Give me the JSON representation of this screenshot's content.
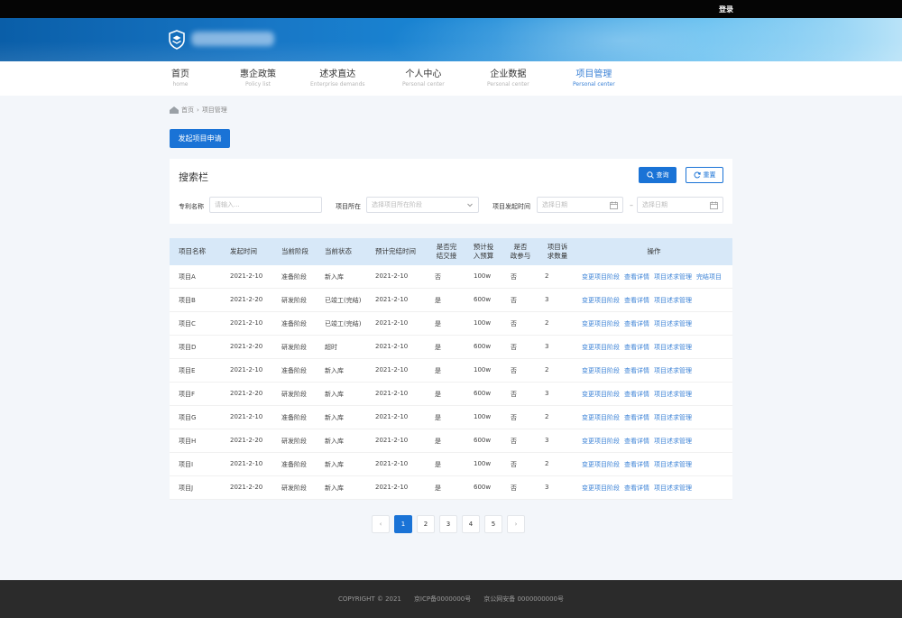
{
  "topbar": {
    "login": "登录"
  },
  "nav": [
    {
      "cn": "首页",
      "en": "home",
      "active": false
    },
    {
      "cn": "惠企政策",
      "en": "Policy list",
      "active": false
    },
    {
      "cn": "述求直达",
      "en": "Enterprise demands",
      "active": false
    },
    {
      "cn": "个人中心",
      "en": "Personal center",
      "active": false
    },
    {
      "cn": "企业数据",
      "en": "Personal center",
      "active": false
    },
    {
      "cn": "项目管理",
      "en": "Personal center",
      "active": true
    }
  ],
  "breadcrumb": {
    "home": "首页",
    "separator": "›",
    "current": "项目管理"
  },
  "actions": {
    "create": "发起项目申请"
  },
  "search": {
    "title": "搜索栏",
    "query": "查询",
    "reset": "重置",
    "patent_label": "专利名称",
    "patent_placeholder": "请输入...",
    "location_label": "项目所在",
    "location_placeholder": "选择项目所在阶段",
    "date_label": "项目发起时间",
    "date_start_placeholder": "选择日期",
    "date_end_placeholder": "选择日期",
    "range_sep": "–"
  },
  "table": {
    "headers": [
      "项目名称",
      "发起时间",
      "当前阶段",
      "当前状态",
      "预计完结时间",
      "是否完\n结交接",
      "预计投\n入预算",
      "是否\n政参与",
      "项目诉\n求数量",
      "操作"
    ],
    "rows": [
      {
        "name": "项目A",
        "start": "2021-2-10",
        "stage": "准备阶段",
        "status": "新入库",
        "end": "2021-2-10",
        "handover": "否",
        "budget": "100w",
        "gov": "否",
        "count": "2",
        "ops": [
          "变更项目阶段",
          "查看详情",
          "项目述求管理",
          "完结项目"
        ]
      },
      {
        "name": "项目B",
        "start": "2021-2-20",
        "stage": "研发阶段",
        "status": "已竣工(完结)",
        "end": "2021-2-10",
        "handover": "是",
        "budget": "600w",
        "gov": "否",
        "count": "3",
        "ops": [
          "变更项目阶段",
          "查看详情",
          "项目述求管理"
        ]
      },
      {
        "name": "项目C",
        "start": "2021-2-10",
        "stage": "准备阶段",
        "status": "已竣工(完结)",
        "end": "2021-2-10",
        "handover": "是",
        "budget": "100w",
        "gov": "否",
        "count": "2",
        "ops": [
          "变更项目阶段",
          "查看详情",
          "项目述求管理"
        ]
      },
      {
        "name": "项目D",
        "start": "2021-2-20",
        "stage": "研发阶段",
        "status": "超时",
        "end": "2021-2-10",
        "handover": "是",
        "budget": "600w",
        "gov": "否",
        "count": "3",
        "ops": [
          "变更项目阶段",
          "查看详情",
          "项目述求管理"
        ]
      },
      {
        "name": "项目E",
        "start": "2021-2-10",
        "stage": "准备阶段",
        "status": "新入库",
        "end": "2021-2-10",
        "handover": "是",
        "budget": "100w",
        "gov": "否",
        "count": "2",
        "ops": [
          "变更项目阶段",
          "查看详情",
          "项目述求管理"
        ]
      },
      {
        "name": "项目F",
        "start": "2021-2-20",
        "stage": "研发阶段",
        "status": "新入库",
        "end": "2021-2-10",
        "handover": "是",
        "budget": "600w",
        "gov": "否",
        "count": "3",
        "ops": [
          "变更项目阶段",
          "查看详情",
          "项目述求管理"
        ]
      },
      {
        "name": "项目G",
        "start": "2021-2-10",
        "stage": "准备阶段",
        "status": "新入库",
        "end": "2021-2-10",
        "handover": "是",
        "budget": "100w",
        "gov": "否",
        "count": "2",
        "ops": [
          "变更项目阶段",
          "查看详情",
          "项目述求管理"
        ]
      },
      {
        "name": "项目H",
        "start": "2021-2-20",
        "stage": "研发阶段",
        "status": "新入库",
        "end": "2021-2-10",
        "handover": "是",
        "budget": "600w",
        "gov": "否",
        "count": "3",
        "ops": [
          "变更项目阶段",
          "查看详情",
          "项目述求管理"
        ]
      },
      {
        "name": "项目I",
        "start": "2021-2-10",
        "stage": "准备阶段",
        "status": "新入库",
        "end": "2021-2-10",
        "handover": "是",
        "budget": "100w",
        "gov": "否",
        "count": "2",
        "ops": [
          "变更项目阶段",
          "查看详情",
          "项目述求管理"
        ]
      },
      {
        "name": "项目J",
        "start": "2021-2-20",
        "stage": "研发阶段",
        "status": "新入库",
        "end": "2021-2-10",
        "handover": "是",
        "budget": "600w",
        "gov": "否",
        "count": "3",
        "ops": [
          "变更项目阶段",
          "查看详情",
          "项目述求管理"
        ]
      }
    ]
  },
  "pagination": {
    "prev": "‹",
    "next": "›",
    "pages": [
      "1",
      "2",
      "3",
      "4",
      "5"
    ],
    "current": "1"
  },
  "footer": {
    "copyright": "COPYRIGHT © 2021",
    "icp": "京ICP备0000000号",
    "police": "京公网安备 0000000000号"
  },
  "colors": {
    "primary": "#1a73d6",
    "link": "#3b82d6",
    "header_bg": "#d7e8f8",
    "footer_bg": "#2b2b2b"
  }
}
